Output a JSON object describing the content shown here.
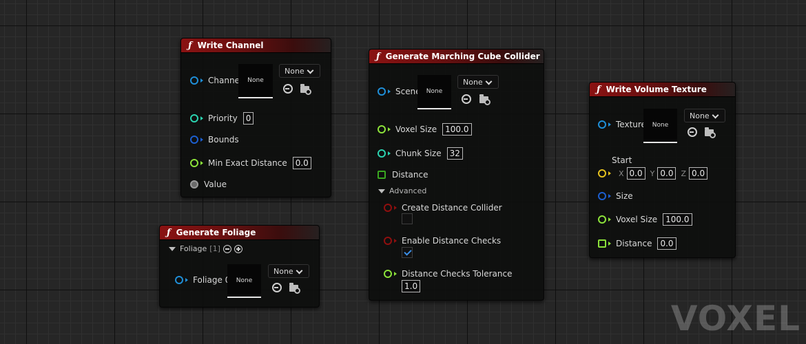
{
  "write_channel": {
    "title": "Write Channel",
    "channel_label": "Channel",
    "channel_asset": "None",
    "channel_dropdown": "None",
    "priority_label": "Priority",
    "priority_value": "0",
    "bounds_label": "Bounds",
    "min_exact_distance_label": "Min Exact Distance",
    "min_exact_distance_value": "0.0",
    "value_label": "Value"
  },
  "generate_foliage": {
    "title": "Generate Foliage",
    "foliage_group_label": "Foliage",
    "foliage_count": "[1]",
    "foliage0_label": "Foliage 0",
    "foliage0_asset": "None",
    "foliage0_dropdown": "None"
  },
  "marching_cube": {
    "title": "Generate Marching Cube Collider",
    "scene_label": "Scene",
    "scene_asset": "None",
    "scene_dropdown": "None",
    "voxel_size_label": "Voxel Size",
    "voxel_size_value": "100.0",
    "chunk_size_label": "Chunk Size",
    "chunk_size_value": "32",
    "distance_label": "Distance",
    "advanced_label": "Advanced",
    "create_distance_collider_label": "Create Distance Collider",
    "enable_distance_checks_label": "Enable Distance Checks",
    "distance_checks_tolerance_label": "Distance Checks Tolerance",
    "distance_checks_tolerance_value": "1.0"
  },
  "write_volume_texture": {
    "title": "Write Volume Texture",
    "texture_label": "Texture",
    "texture_asset": "None",
    "texture_dropdown": "None",
    "start_label": "Start",
    "x_label": "X",
    "x_value": "0.0",
    "y_label": "Y",
    "y_value": "0.0",
    "z_label": "Z",
    "z_value": "0.0",
    "size_label": "Size",
    "voxel_size_label": "Voxel Size",
    "voxel_size_value": "100.0",
    "distance_label": "Distance",
    "distance_value": "0.0"
  },
  "watermark": "VOXEL",
  "colors": {
    "object_pin": "#1f8fd8",
    "int_pin": "#2bd3b0",
    "float_pin": "#8ce23a",
    "bounds_pin": "#1c5fd0",
    "bool_pin": "#8f0f0f",
    "vector_pin": "#e6c21e",
    "value_pin": "#9a9a9a",
    "distance_pin": "#3aa820",
    "header_red": "#8a1212",
    "check_blue": "#3a8fe8"
  }
}
